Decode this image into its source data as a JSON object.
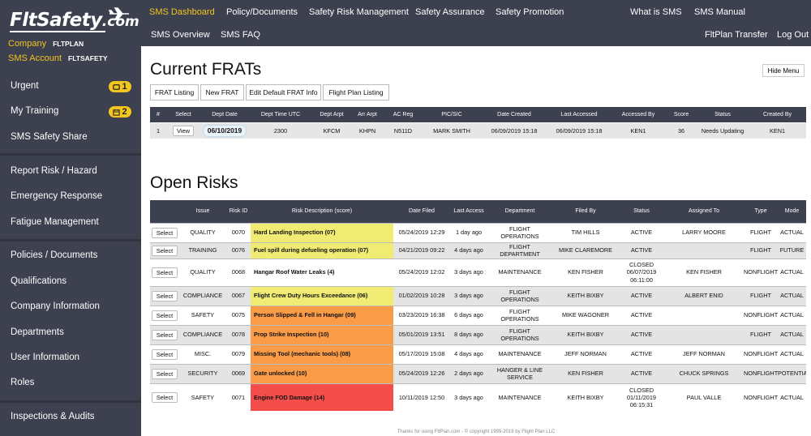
{
  "colors": {
    "sidebar": "#3c404f",
    "accent": "#f3c51f",
    "risk_yellow": "#f0eb72",
    "risk_orange": "#f99b47",
    "risk_red": "#f34e49"
  },
  "logo": {
    "main": "FltSafety",
    "suffix": ".com"
  },
  "account": {
    "company_label": "Company",
    "company_value": "FLTPLAN",
    "sms_label": "SMS Account",
    "sms_value": "FLTSAFETY"
  },
  "sidebar": {
    "groups": [
      [
        {
          "label": "Urgent",
          "badge": "1",
          "badge_icon": "alert-icon"
        },
        {
          "label": "My Training",
          "badge": "2",
          "badge_icon": "calendar-icon"
        },
        {
          "label": "SMS Safety Share"
        }
      ],
      [
        {
          "label": "Report Risk / Hazard"
        },
        {
          "label": "Emergency Response"
        },
        {
          "label": "Fatigue Management"
        }
      ],
      [
        {
          "label": "Policies / Documents"
        },
        {
          "label": "Qualifications"
        },
        {
          "label": "Company Information"
        },
        {
          "label": "Departments"
        },
        {
          "label": "User Information"
        },
        {
          "label": "Roles"
        }
      ],
      [
        {
          "label": "Inspections & Audits"
        }
      ]
    ]
  },
  "topnav": {
    "row1": [
      "SMS Dashboard",
      "Policy/Documents",
      "Safety Risk Management",
      "Safety Assurance",
      "Safety Promotion",
      "What is SMS",
      "SMS Manual"
    ],
    "row2": [
      "SMS Overview",
      "SMS FAQ",
      "FltPlan Transfer",
      "Log Out"
    ]
  },
  "main": {
    "hide_menu": "Hide Menu",
    "frats_title": "Current FRATs",
    "frat_buttons": [
      "FRAT Listing",
      "New FRAT",
      "Edit Default FRAT Info",
      "Flight Plan Listing"
    ],
    "frat_headers": [
      "#",
      "Select",
      "Dept Date",
      "Dept Time UTC",
      "Dept Arpt",
      "Arr Arpt",
      "AC Reg",
      "PIC/SIC",
      "Date Created",
      "Last Accessed",
      "Accessed By",
      "Score",
      "Status",
      "Created By"
    ],
    "frat_rows": [
      [
        "1",
        "View",
        "06/10/2019",
        "2300",
        "KFCM",
        "KHPN",
        "N511D",
        "MARK SMITH",
        "06/09/2019 15:18",
        "06/09/2019 15:18",
        "KEN1",
        "36",
        "Needs Updating",
        "KEN1"
      ]
    ],
    "risks_title": "Open Risks",
    "risk_headers": [
      "",
      "Issue",
      "Risk ID",
      "Risk Description (score)",
      "Date Filed",
      "Last Access",
      "Department",
      "Filed By",
      "Status",
      "Assigned To",
      "Type",
      "Mode"
    ],
    "risk_rows": [
      {
        "select": "Select",
        "issue": "QUALITY",
        "id": "0070",
        "desc": "Hard Landing Inspection (07)",
        "level": "yellow",
        "filed": "05/24/2019 12:29",
        "access": "1 day ago",
        "dept": "FLIGHT OPERATIONS",
        "by": "TIM HILLS",
        "status": "ACTIVE",
        "assigned": "LARRY MOORE",
        "type": "FLIGHT",
        "mode": "ACTUAL"
      },
      {
        "select": "Select",
        "issue": "TRAINING",
        "id": "0076",
        "desc": "Fuel spill during defueling operation (07)",
        "level": "yellow",
        "filed": "04/21/2019 09:22",
        "access": "4 days ago",
        "dept": "FLIGHT DEPARTMENT",
        "by": "MIKE CLAREMORE",
        "status": "ACTIVE",
        "assigned": "",
        "type": "FLIGHT",
        "mode": "FUTURE"
      },
      {
        "select": "Select",
        "issue": "QUALITY",
        "id": "0068",
        "desc": "Hangar Roof Water Leaks (4)",
        "level": "none",
        "filed": "05/24/2019 12:02",
        "access": "3 days ago",
        "dept": "MAINTENANCE",
        "by": "KEN FISHER",
        "status": "CLOSED 06/07/2019 06:11:00",
        "assigned": "KEN FISHER",
        "type": "NONFLIGHT",
        "mode": "ACTUAL"
      },
      {
        "select": "Select",
        "issue": "COMPLIANCE",
        "id": "0067",
        "desc": "Flight Crew Duty Hours Exceedance (06)",
        "level": "yellow",
        "filed": "01/02/2019 10:28",
        "access": "3 days ago",
        "dept": "FLIGHT OPERATIONS",
        "by": "KEITH BIXBY",
        "status": "ACTIVE",
        "assigned": "ALBERT ENID",
        "type": "FLIGHT",
        "mode": "ACTUAL"
      },
      {
        "select": "Select",
        "issue": "SAFETY",
        "id": "0075",
        "desc": "Person Slipped & Fell in Hangar (09)",
        "level": "orange",
        "filed": "03/23/2019 16:38",
        "access": "6 days ago",
        "dept": "FLIGHT OPERATIONS",
        "by": "MIKE WAGONER",
        "status": "ACTIVE",
        "assigned": "",
        "type": "NONFLIGHT",
        "mode": "ACTUAL"
      },
      {
        "select": "Select",
        "issue": "COMPLIANCE",
        "id": "0078",
        "desc": "Prop Strike Inspection (10)",
        "level": "orange",
        "filed": "05/01/2019 13:51",
        "access": "8 days ago",
        "dept": "FLIGHT OPERATIONS",
        "by": "KEITH BIXBY",
        "status": "ACTIVE",
        "assigned": "",
        "type": "FLIGHT",
        "mode": "ACTUAL"
      },
      {
        "select": "Select",
        "issue": "MISC.",
        "id": "0079",
        "desc": "Missing Tool (mechanic tools) (08)",
        "level": "orange",
        "filed": "05/17/2019 15:08",
        "access": "4 days ago",
        "dept": "MAINTENANCE",
        "by": "JEFF NORMAN",
        "status": "ACTIVE",
        "assigned": "JEFF NORMAN",
        "type": "NONFLIGHT",
        "mode": "ACTUAL"
      },
      {
        "select": "Select",
        "issue": "SECURITY",
        "id": "0069",
        "desc": "Gate unlocked (10)",
        "level": "orange",
        "filed": "05/24/2019 12:26",
        "access": "2 days ago",
        "dept": "HANGER & LINE SERVICE",
        "by": "KEN FISHER",
        "status": "ACTIVE",
        "assigned": "CHUCK SPRINGS",
        "type": "NONFLIGHT",
        "mode": "POTENTIAL"
      },
      {
        "select": "Select",
        "issue": "SAFETY",
        "id": "0071",
        "desc": "Engine FOD Damage (14)",
        "level": "red",
        "filed": "10/11/2019 12:50",
        "access": "3 days ago",
        "dept": "MAINTENANCE",
        "by": "KEITH BIXBY",
        "status": "CLOSED 01/11/2019 06:15:31",
        "assigned": "PAUL VALLE",
        "type": "NONFLIGHT",
        "mode": "ACTUAL"
      }
    ],
    "footer": "Thanks for using FltPlan.com - © copyright 1999-2019 by Flight Plan LLC"
  }
}
